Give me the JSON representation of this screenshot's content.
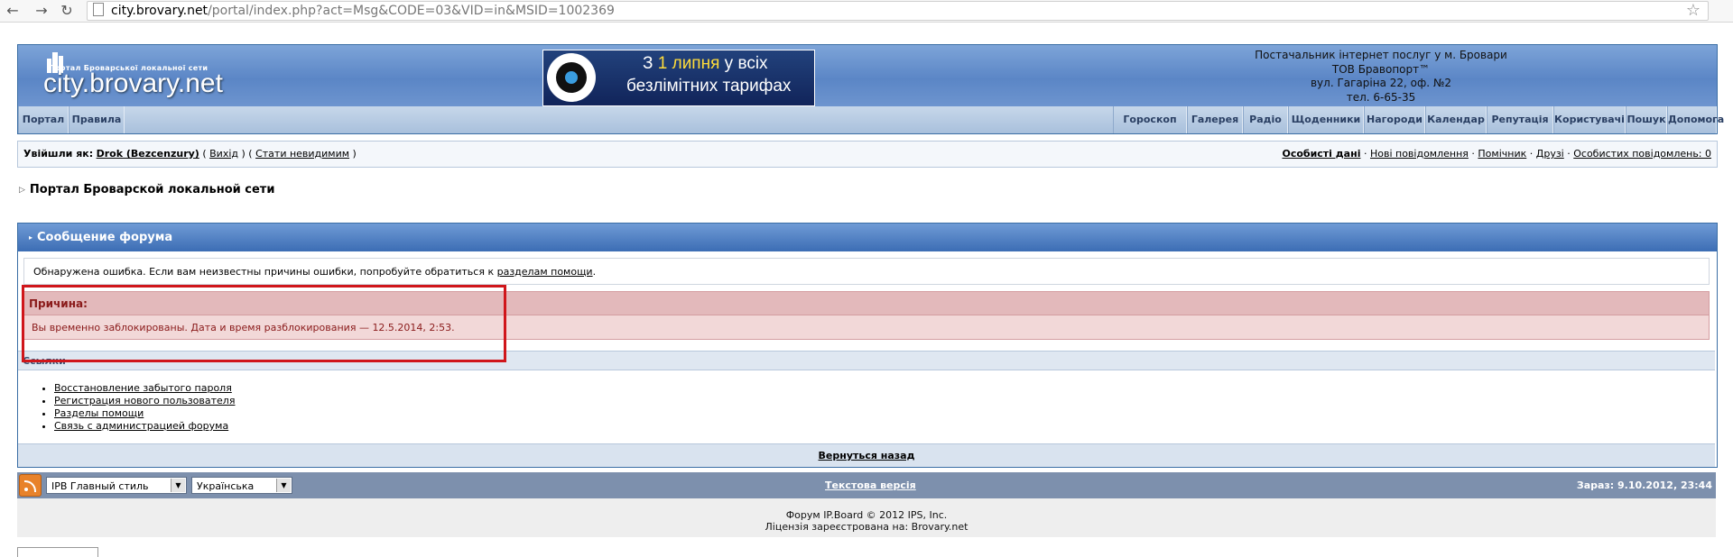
{
  "browser": {
    "url_host": "city.brovary.net",
    "url_path": "/portal/index.php?act=Msg&CODE=03&VID=in&MSID=1002369",
    "back_icon": "arrow-left-icon",
    "forward_icon": "arrow-right-icon",
    "reload_icon": "reload-icon"
  },
  "header": {
    "logo_tagline": "Портал Броварської локальної сети",
    "logo_text": "city.brovary.net",
    "banner_line1_prefix": "З ",
    "banner_line1_highlight": "1 липня",
    "banner_line1_suffix": " у всіх",
    "banner_line2": "безлімітних тарифах",
    "provider_lines": [
      "Постачальник інтернет послуг у м. Бровари",
      "ТОВ Бравопорт™",
      "вул. Гагаріна 22, оф. №2",
      "тел. 6-65-35"
    ]
  },
  "nav": {
    "left": [
      "Портал",
      "Правила"
    ],
    "right": [
      "Гороскоп",
      "Галерея",
      "Радіо",
      "Щоденники",
      "Нагороди",
      "Календар",
      "Репутація",
      "Користувачі",
      "Пошук",
      "Допомога"
    ]
  },
  "userbar": {
    "logged_in_label": "Увійшли як:",
    "username": "Drok (Bezcenzury)",
    "logout": "Вихід",
    "invisible": "Стати невидимим",
    "links": [
      "Особисті дані",
      "Нові повідомлення",
      "Помічник",
      "Друзі",
      "Особистих повідомлень: 0"
    ]
  },
  "breadcrumb": "Портал Броварской локальной сети",
  "panel": {
    "title": "Сообщение форума",
    "notice_text": "Обнаружена ошибка. Если вам неизвестны причины ошибки, попробуйте обратиться к ",
    "notice_link": "разделам помощи",
    "notice_end": ".",
    "reason_title": "Причина:",
    "reason_text": "Вы временно заблокированы. Дата и время разблокирования — 12.5.2014, 2:53.",
    "links_title": "Ссылки",
    "links": [
      "Восстановление забытого пароля",
      "Регистрация нового пользователя",
      "Разделы помощи",
      "Связь с администрацией форума"
    ],
    "back": "Вернуться назад"
  },
  "footer": {
    "skin_select": "IPB Главный стиль",
    "lang_select": "Українська",
    "text_version": "Текстова версія",
    "time": "Зараз: 9.10.2012, 23:44",
    "copyright": "Форум IP.Board © 2012  IPS, Inc.",
    "license": "Ліцензія зареєстрована на: Brovary.net"
  },
  "colors": {
    "header_blue": "#5b86c6",
    "error_red": "#8a1a1a",
    "highlight_red": "#d0161b"
  }
}
